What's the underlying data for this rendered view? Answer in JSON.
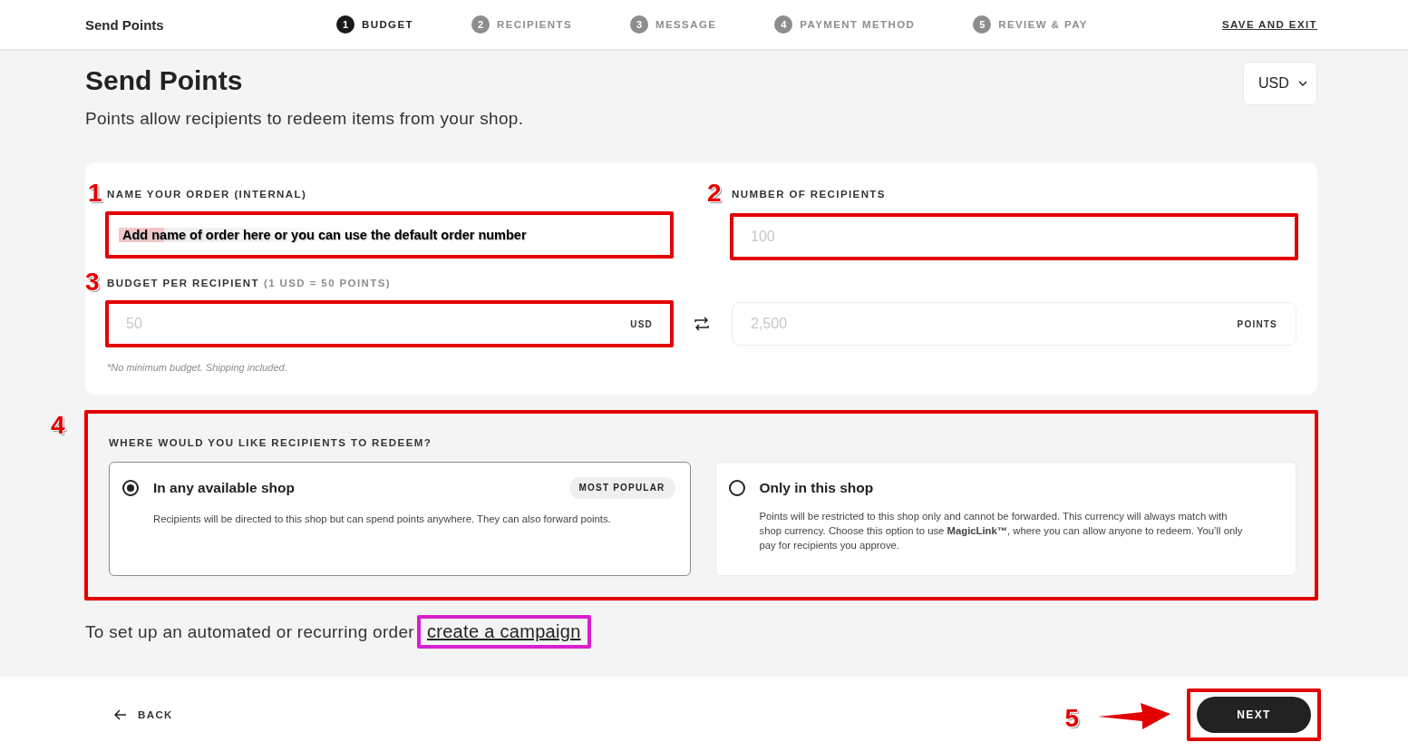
{
  "header": {
    "title": "Send Points",
    "steps": [
      {
        "number": "1",
        "label": "BUDGET",
        "selected": true
      },
      {
        "number": "2",
        "label": "RECIPIENTS",
        "selected": false
      },
      {
        "number": "3",
        "label": "MESSAGE",
        "selected": false
      },
      {
        "number": "4",
        "label": "PAYMENT METHOD",
        "selected": false
      },
      {
        "number": "5",
        "label": "REVIEW & PAY",
        "selected": false
      }
    ],
    "save_link": "SAVE AND EXIT"
  },
  "page": {
    "title": "Send Points",
    "subtitle": "Points allow recipients to redeem items from your shop.",
    "currency": "USD"
  },
  "form": {
    "order_name": {
      "marker": "1",
      "label": "NAME YOUR ORDER (INTERNAL)",
      "value": "Add name of order here or you can use the default order number",
      "highlighted": true
    },
    "recipients": {
      "marker": "2",
      "label": "NUMBER OF RECIPIENTS",
      "placeholder": "100",
      "highlighted": true
    },
    "budget": {
      "marker": "3",
      "label": "BUDGET PER RECIPIENT",
      "label_note": "(1 USD = 50 POINTS)",
      "placeholder": "50",
      "unit": "USD",
      "highlighted": true
    },
    "points": {
      "placeholder": "2,500",
      "unit": "POINTS"
    },
    "note": "*No minimum budget. Shipping included."
  },
  "redeem": {
    "marker": "4",
    "highlighted": true,
    "label": "WHERE WOULD YOU LIKE RECIPIENTS TO REDEEM?",
    "options": [
      {
        "title": "In any available shop",
        "badge": "MOST POPULAR",
        "description": "Recipients will be directed to this shop but can spend points anywhere. They can also forward points.",
        "selected": true
      },
      {
        "title": "Only in this shop",
        "description": "Points will be restricted to this shop only and cannot be forwarded. This currency will always match with shop currency. Choose this option to use **MagicLink™**, where you can allow anyone to redeem. You’ll only pay for recipients you approve.",
        "selected": false
      }
    ]
  },
  "campaign": {
    "text": "To set up an automated or recurring order",
    "link": "create a campaign",
    "highlighted": true
  },
  "footer": {
    "back": "BACK",
    "next": "NEXT",
    "marker": "5",
    "highlighted": true
  }
}
